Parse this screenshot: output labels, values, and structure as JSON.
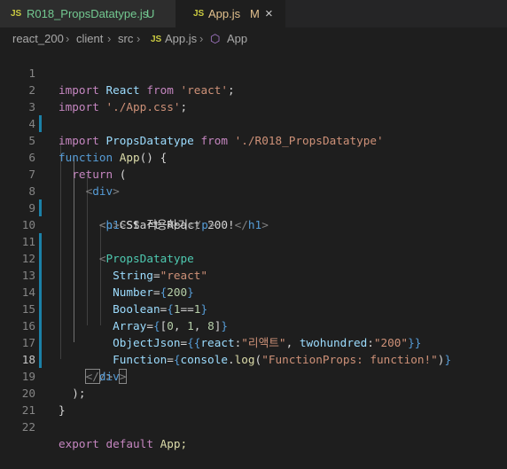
{
  "tabs": [
    {
      "icon_text": "JS",
      "label": "R018_PropsDatatype.js",
      "status": "U"
    },
    {
      "icon_text": "JS",
      "label": "App.js",
      "status": "M",
      "close_icon": "×"
    }
  ],
  "breadcrumb": {
    "items": [
      "react_200",
      "client",
      "src",
      "App.js",
      "App"
    ],
    "separator": "›",
    "file_icon_text": "JS",
    "symbol_icon": "⬡"
  },
  "editor": {
    "current_line": 18,
    "lines": [
      {
        "n": "1"
      },
      {
        "n": "2"
      },
      {
        "n": "3"
      },
      {
        "n": "4"
      },
      {
        "n": "5"
      },
      {
        "n": "6"
      },
      {
        "n": "7"
      },
      {
        "n": "8"
      },
      {
        "n": "9"
      },
      {
        "n": "10"
      },
      {
        "n": "11"
      },
      {
        "n": "12"
      },
      {
        "n": "13"
      },
      {
        "n": "14"
      },
      {
        "n": "15"
      },
      {
        "n": "16"
      },
      {
        "n": "17"
      },
      {
        "n": "18"
      },
      {
        "n": "19"
      },
      {
        "n": "20"
      },
      {
        "n": "21"
      },
      {
        "n": "22"
      }
    ],
    "tokens": {
      "import": "import",
      "react_name": "React",
      "from": "from",
      "react_str": "'react'",
      "semi": ";",
      "app_css_str": "'./App.css'",
      "propsdatatype": "PropsDatatype",
      "propsdatatype_str": "'./R018_PropsDatatype'",
      "function": "function",
      "app": "App",
      "parens_brace": "() {",
      "return": "return",
      "open_paren": "(",
      "lt": "<",
      "gt": ">",
      "lt_slash": "</",
      "slash_gt": "/>",
      "div": "div",
      "h1": "h1",
      "h1_text": "Start React 200!",
      "p": "p",
      "p_text": "CSS 적용하기",
      "attr_string": "String",
      "eq": "=",
      "val_react": "\"react\"",
      "attr_number": "Number",
      "lbrace": "{",
      "rbrace": "}",
      "num_200": "200",
      "attr_boolean": "Boolean",
      "bool_expr_1": "1",
      "bool_eq": "==",
      "attr_array": "Array",
      "arr_open": "[",
      "arr_0": "0",
      "comma_space": ", ",
      "arr_1": "1",
      "arr_8": "8",
      "arr_close": "]",
      "attr_objectjson": "ObjectJson",
      "obj_open": "{{",
      "obj_react_key": "react",
      "colon": ":",
      "obj_react_val": "\"리액트\"",
      "obj_key2": "twohundred",
      "obj_val2": "\"200\"",
      "obj_close": "}}",
      "attr_function": "Function",
      "console": "console",
      "dot": ".",
      "log": "log",
      "log_arg": "\"FunctionProps: function!\"",
      "close_paren": ")",
      "close_paren_semi": ");",
      "close_brace": "}",
      "export": "export",
      "default": "default",
      "app_semi": "App;"
    }
  },
  "colors": {
    "background": "#1e1e1e",
    "keyword": "#569cd6",
    "control": "#c586c0",
    "string": "#ce9178",
    "function": "#dcdcaa",
    "variable": "#9cdcfe",
    "class": "#4ec9b0",
    "modified_gutter": "#1b81a8"
  }
}
